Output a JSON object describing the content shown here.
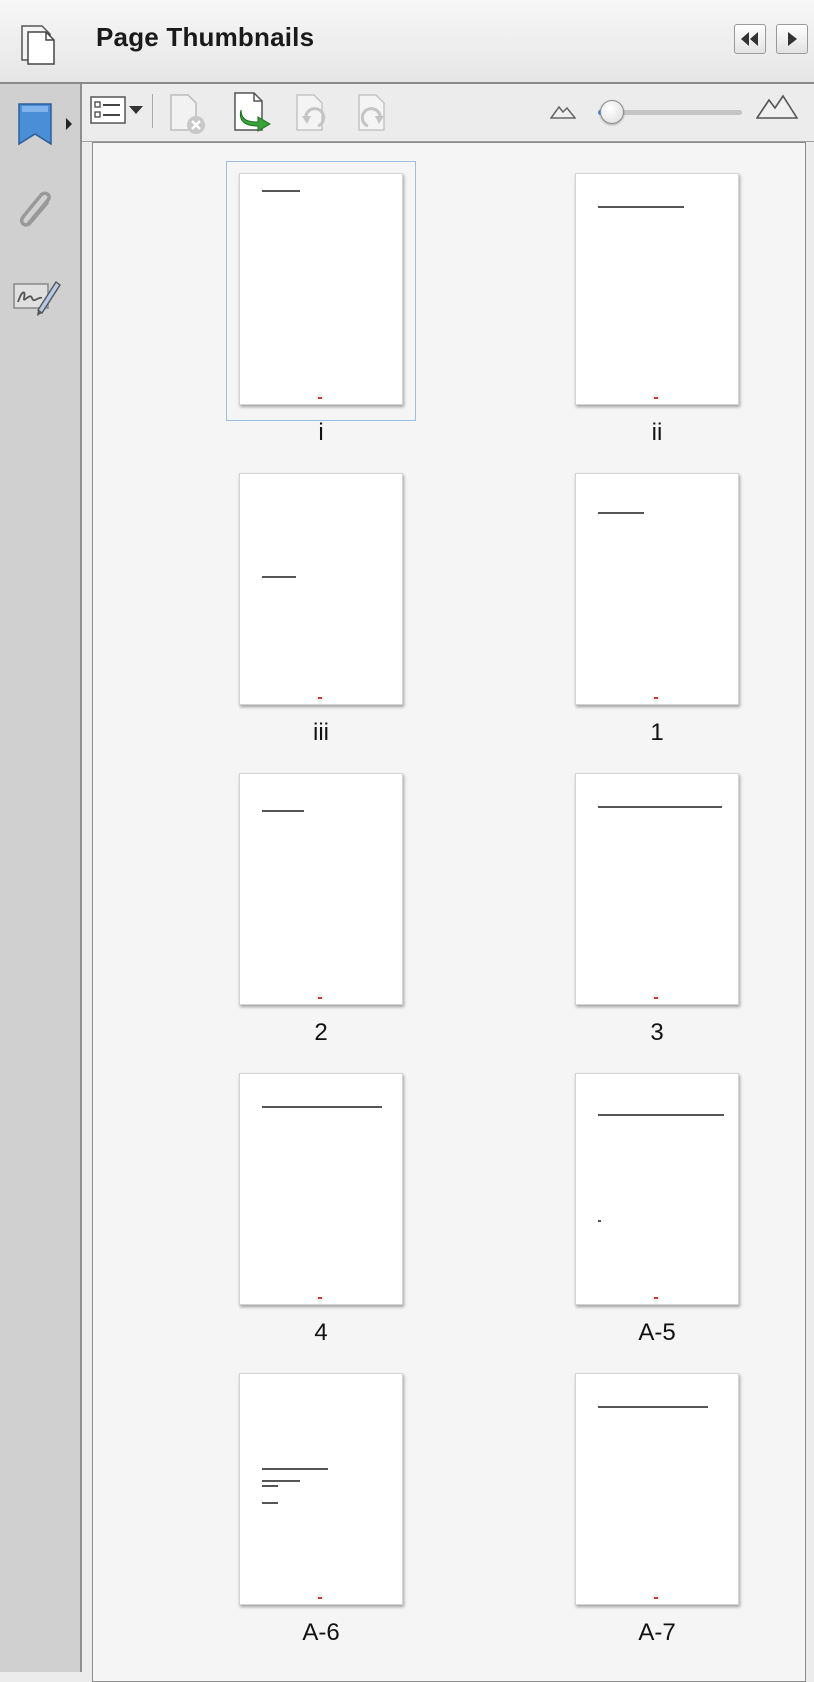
{
  "header": {
    "title": "Page Thumbnails",
    "icons": [
      "pages-icon",
      "rewind-icon",
      "play-icon"
    ]
  },
  "rail": {
    "icons": [
      "bookmark-icon",
      "paperclip-icon",
      "signature-icon"
    ]
  },
  "toolbar": {
    "icons": [
      "options-menu-icon",
      "delete-page-icon",
      "insert-page-icon",
      "rotate-ccw-icon",
      "rotate-cw-icon",
      "zoom-small-icon",
      "zoom-large-icon"
    ],
    "zoom_slider": {
      "value": 0.1
    }
  },
  "thumbnails": [
    {
      "label": "i",
      "selected": true
    },
    {
      "label": "ii",
      "selected": false
    },
    {
      "label": "iii",
      "selected": false
    },
    {
      "label": "1",
      "selected": false
    },
    {
      "label": "2",
      "selected": false
    },
    {
      "label": "3",
      "selected": false
    },
    {
      "label": "4",
      "selected": false
    },
    {
      "label": "A-5",
      "selected": false
    },
    {
      "label": "A-6",
      "selected": false
    },
    {
      "label": "A-7",
      "selected": false
    }
  ],
  "colors": {
    "selection_border": "#9dbfe0",
    "slider_accent": "#3d8be0",
    "bookmark_blue": "#4a8ed8",
    "insert_green": "#3aa23a"
  }
}
